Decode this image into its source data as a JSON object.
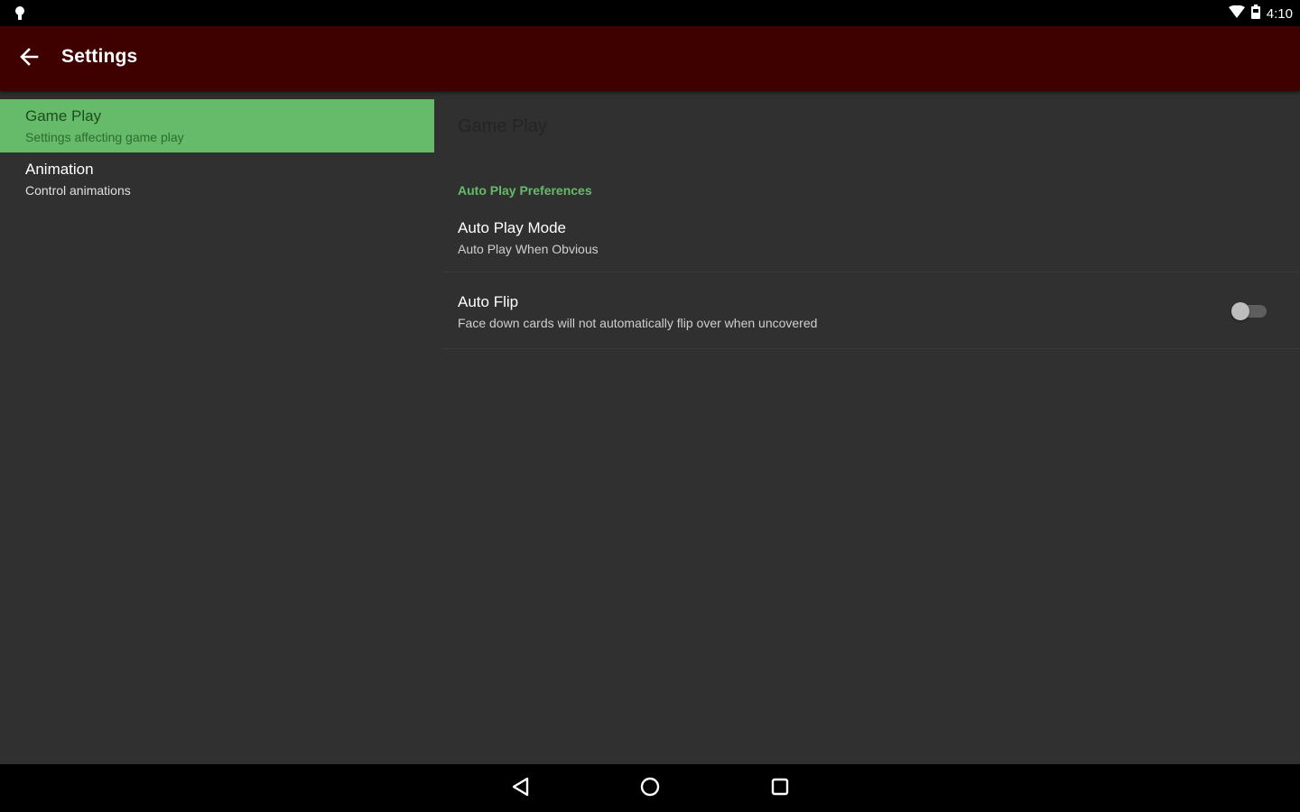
{
  "status_bar": {
    "time": "4:10",
    "left_icon": "notification-bulb-icon",
    "right_icons": [
      "wifi-icon",
      "battery-icon"
    ]
  },
  "app_bar": {
    "title": "Settings",
    "back_icon": "arrow-back-icon",
    "background_color": "#3f0000"
  },
  "headers": [
    {
      "title": "Game Play",
      "summary": "Settings affecting game play",
      "selected": true
    },
    {
      "title": "Animation",
      "summary": "Control animations",
      "selected": false
    }
  ],
  "detail": {
    "breadcrumb": "Game Play",
    "category": "Auto Play Preferences",
    "prefs": [
      {
        "title": "Auto Play Mode",
        "summary": "Auto Play When Obvious"
      },
      {
        "title": "Auto Flip",
        "summary": "Face down cards will not automatically flip over when uncovered",
        "switch_on": false
      }
    ]
  },
  "colors": {
    "accent": "#66bb6a",
    "background": "#303030"
  },
  "nav_bar": {
    "icons": [
      "nav-back-icon",
      "nav-home-icon",
      "nav-recents-icon"
    ]
  }
}
